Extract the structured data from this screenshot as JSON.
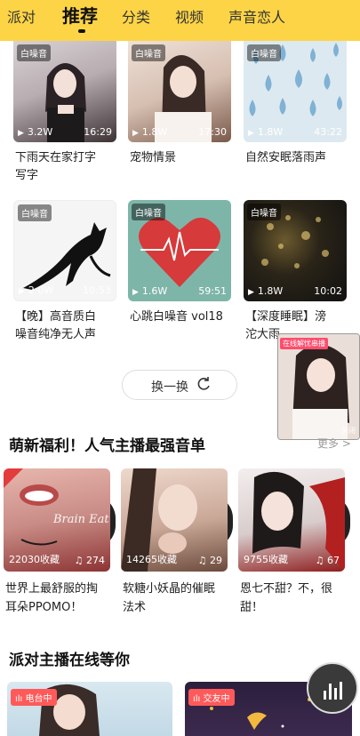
{
  "nav": {
    "tabs": [
      "派对",
      "推荐",
      "分类",
      "视频",
      "声音恋人"
    ],
    "active": "推荐"
  },
  "videos": [
    {
      "tag": "白噪音",
      "plays": "3.2W",
      "duration": "16:29",
      "title_line1": "下雨天在家打字",
      "title_line2": "写字",
      "colors": [
        "#c9c3c6",
        "#4a3d3f"
      ]
    },
    {
      "tag": "白噪音",
      "plays": "1.8W",
      "duration": "17:30",
      "title_line1": "宠物情景",
      "title_line2": "",
      "colors": [
        "#e9d7cc",
        "#8b6553"
      ]
    },
    {
      "tag": "白噪音",
      "plays": "1.8W",
      "duration": "43:22",
      "title_line1": "自然安眠落雨声",
      "title_line2": "",
      "colors": [
        "#dbe7ef",
        "#7fb2d2"
      ]
    },
    {
      "tag": "白噪音",
      "plays": "2.0W",
      "duration": "10:53",
      "title_line1": "【晚】高音质白",
      "title_line2": "噪音纯净无人声",
      "colors": [
        "#f4f4f4",
        "#111111"
      ]
    },
    {
      "tag": "白噪音",
      "plays": "1.6W",
      "duration": "59:51",
      "title_line1": "心跳白噪音 vol18",
      "title_line2": "",
      "colors": [
        "#7eb5a9",
        "#d63a3a"
      ]
    },
    {
      "tag": "白噪音",
      "plays": "1.8W",
      "duration": "10:02",
      "title_line1": "【深度睡眠】滂",
      "title_line2": "沱大雨",
      "colors": [
        "#1c1f24",
        "#c9b36a"
      ]
    }
  ],
  "refresh_label": "换一换",
  "float_live": {
    "label": "在线解忧串播",
    "close": "关闭"
  },
  "section_playlist": {
    "title": "萌新福利！人气主播最强音单",
    "more": "更多 >"
  },
  "playlists": [
    {
      "favs": "22030收藏",
      "count": "274",
      "title_line1": "世界上最舒服的掏",
      "title_line2": "耳朵PPOMO！",
      "overlay": "Brain Eat",
      "colors": [
        "#e9b8b0",
        "#a43c3c"
      ]
    },
    {
      "favs": "14265收藏",
      "count": "29",
      "title_line1": "软糖小妖晶的催眠",
      "title_line2": "法术",
      "overlay": "",
      "colors": [
        "#e8d0c4",
        "#6d4a3c"
      ]
    },
    {
      "favs": "9755收藏",
      "count": "67",
      "title_line1": "恩七不甜？不，很",
      "title_line2": "甜！",
      "overlay": "",
      "colors": [
        "#f1eaea",
        "#b32020"
      ]
    }
  ],
  "section_party": {
    "title": "派对主播在线等你"
  },
  "party": [
    {
      "badge": "电台中",
      "colors": [
        "#cfe1ec",
        "#e8b9a6"
      ]
    },
    {
      "badge": "交友中",
      "colors": [
        "#2a1e3a",
        "#f2b840"
      ]
    }
  ]
}
